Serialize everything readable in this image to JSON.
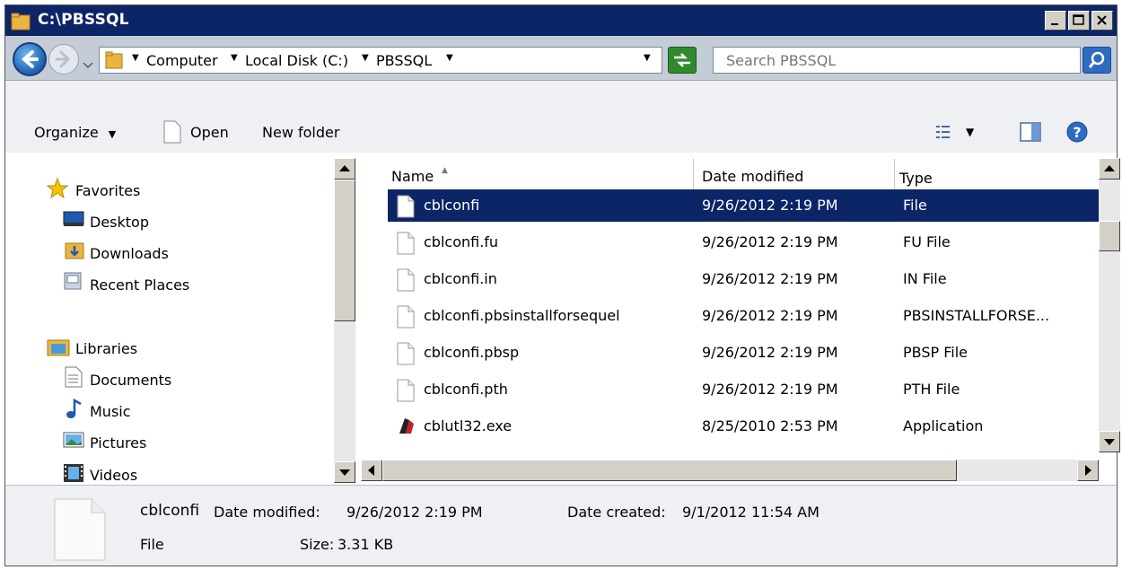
{
  "window": {
    "title": "C:\\PBSSQL"
  },
  "address": {
    "crumbs": [
      "Computer",
      "Local Disk (C:)",
      "PBSSQL"
    ]
  },
  "search": {
    "placeholder": "Search PBSSQL"
  },
  "toolbar": {
    "organize_label": "Organize",
    "open_label": "Open",
    "new_folder_label": "New folder"
  },
  "nav": {
    "favorites_label": "Favorites",
    "favorites": [
      {
        "label": "Desktop",
        "icon": "desktop-icon"
      },
      {
        "label": "Downloads",
        "icon": "downloads-folder-icon"
      },
      {
        "label": "Recent Places",
        "icon": "recent-places-icon"
      }
    ],
    "libraries_label": "Libraries",
    "libraries": [
      {
        "label": "Documents",
        "icon": "documents-icon"
      },
      {
        "label": "Music",
        "icon": "music-icon"
      },
      {
        "label": "Pictures",
        "icon": "pictures-icon"
      },
      {
        "label": "Videos",
        "icon": "videos-icon"
      }
    ]
  },
  "columns": {
    "name": "Name",
    "date": "Date modified",
    "type": "Type"
  },
  "files": [
    {
      "name": "cblconfi",
      "date": "9/26/2012 2:19 PM",
      "type": "File",
      "icon": "file-icon",
      "selected": true
    },
    {
      "name": "cblconfi.fu",
      "date": "9/26/2012 2:19 PM",
      "type": "FU File",
      "icon": "file-icon"
    },
    {
      "name": "cblconfi.in",
      "date": "9/26/2012 2:19 PM",
      "type": "IN File",
      "icon": "file-icon"
    },
    {
      "name": "cblconfi.pbsinstallforsequel",
      "date": "9/26/2012 2:19 PM",
      "type": "PBSINSTALLFORSE...",
      "icon": "file-icon"
    },
    {
      "name": "cblconfi.pbsp",
      "date": "9/26/2012 2:19 PM",
      "type": "PBSP File",
      "icon": "file-icon"
    },
    {
      "name": "cblconfi.pth",
      "date": "9/26/2012 2:19 PM",
      "type": "PTH File",
      "icon": "file-icon"
    },
    {
      "name": "cblutl32.exe",
      "date": "8/25/2010 2:53 PM",
      "type": "Application",
      "icon": "application-icon"
    }
  ],
  "details": {
    "name": "cblconfi",
    "type": "File",
    "modified_label": "Date modified:",
    "modified": "9/26/2012 2:19 PM",
    "created_label": "Date created:",
    "created": "9/1/2012 11:54 AM",
    "size_label": "Size:",
    "size": "3.31 KB"
  },
  "colors": {
    "titlebar": "#0b2566",
    "selection": "#0b2566"
  }
}
